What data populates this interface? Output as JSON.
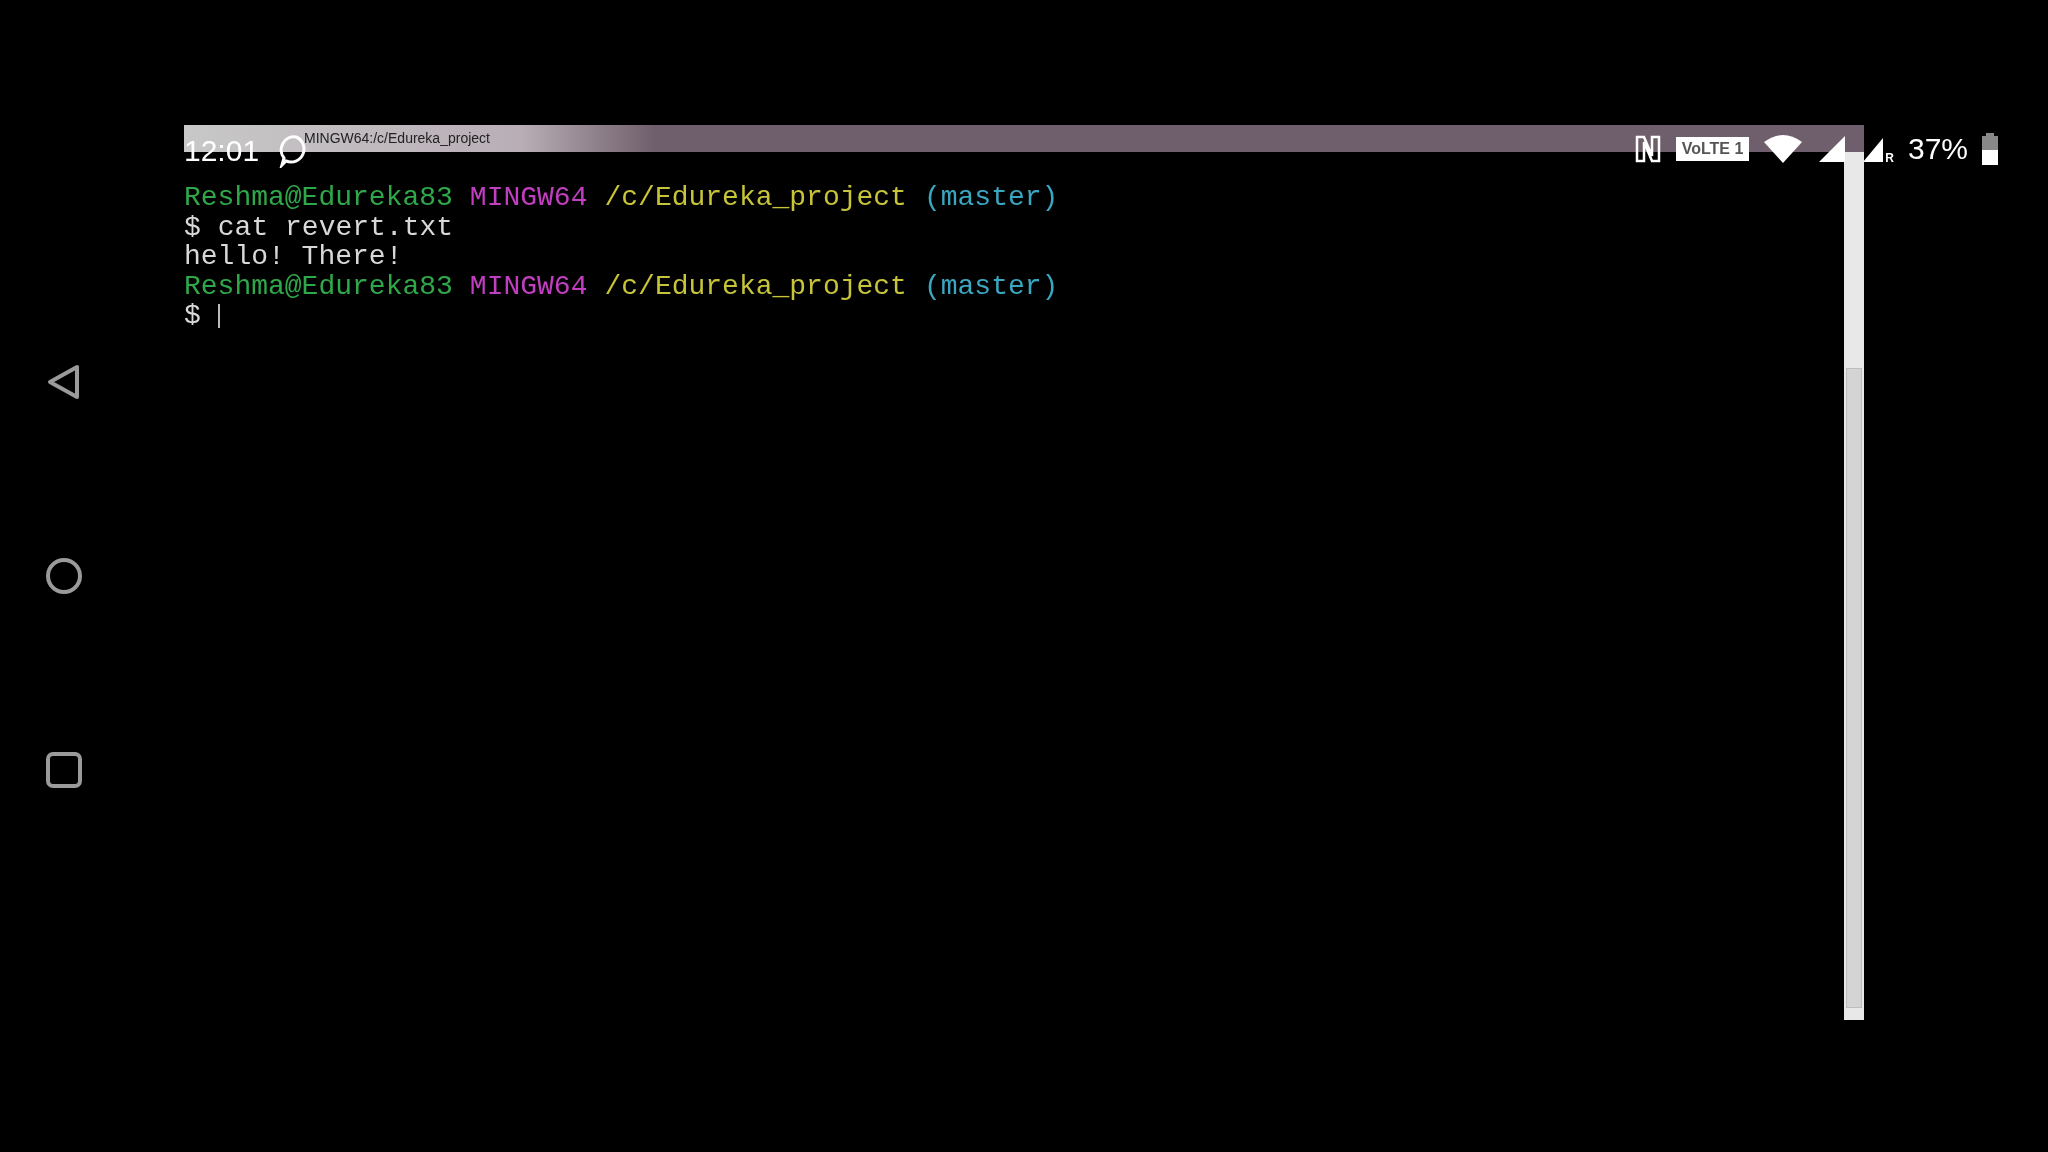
{
  "status_bar": {
    "time": "12:01",
    "network_badge": "VoLTE 1",
    "roaming_mark": "R",
    "battery": "37%"
  },
  "window": {
    "title": "MINGW64:/c/Edureka_project"
  },
  "terminal": {
    "lines": [
      {
        "kind": "prompt",
        "user": "Reshma@Edureka83",
        "shell": "MINGW64",
        "path": "/c/Edureka_project",
        "branch": "(master)"
      },
      {
        "kind": "command",
        "prompt": "$",
        "text": "cat revert.txt"
      },
      {
        "kind": "output",
        "text": "hello! There!"
      },
      {
        "kind": "prompt",
        "user": "Reshma@Edureka83",
        "shell": "MINGW64",
        "path": "/c/Edureka_project",
        "branch": "(master)"
      },
      {
        "kind": "command",
        "prompt": "$",
        "cursor": true
      }
    ]
  }
}
